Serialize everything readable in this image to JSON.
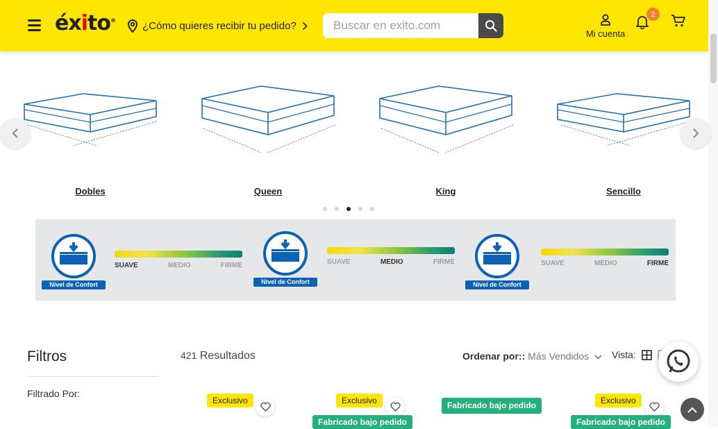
{
  "header": {
    "logo_text": "éxito",
    "location_text": "¿Cómo quieres recibir tu pedido?",
    "search_placeholder": "Buscar en exito.com",
    "account_label": "Mi cuenta",
    "notifications_count": "2",
    "brand_color": "#ffe600"
  },
  "categories": [
    {
      "label": "Dobles"
    },
    {
      "label": "Queen"
    },
    {
      "label": "King"
    },
    {
      "label": "Sencillo"
    }
  ],
  "carousel": {
    "total_dots": 5,
    "active_dot": 3
  },
  "comfort_banner": {
    "badge_label": "Nivel de Confort",
    "levels": [
      "SUAVE",
      "MEDIO",
      "FIRME"
    ],
    "active_levels": [
      "SUAVE",
      "MEDIO",
      "FIRME"
    ]
  },
  "filters": {
    "title": "Filtros",
    "filtered_by": "Filtrado Por:"
  },
  "results": {
    "count": "421",
    "label": "Resultados"
  },
  "sort": {
    "label": "Ordenar por::",
    "value": "Más Vendidos"
  },
  "view": {
    "label": "Vista:"
  },
  "product_tags": {
    "exclusive": "Exclusivo",
    "made_to_order": "Fabricado bajo pedido"
  },
  "icons": {
    "menu": "hamburger-icon",
    "location": "location-pin-icon",
    "search": "search-icon",
    "account": "user-icon",
    "notifications": "bell-icon",
    "cart": "cart-icon",
    "whatsapp": "whatsapp-icon"
  }
}
